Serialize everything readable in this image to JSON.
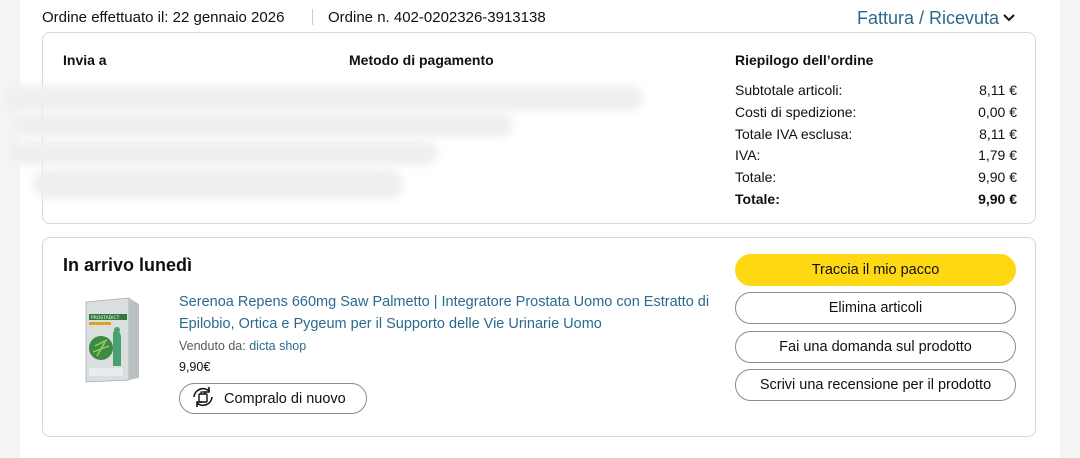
{
  "header": {
    "placed_label": "Ordine effettuato il: 22 gennaio 2026",
    "order_number": "Ordine n. 402-0202326-3913138",
    "invoice_link": "Fattura / Ricevuta"
  },
  "summary": {
    "ship_to_label": "Invia a",
    "payment_label": "Metodo di pagamento",
    "summary_label": "Riepilogo dell’ordine",
    "rows": [
      {
        "label": "Subtotale articoli:",
        "value": "8,11 €"
      },
      {
        "label": "Costi di spedizione:",
        "value": "0,00 €"
      },
      {
        "label": "Totale IVA esclusa:",
        "value": "8,11 €"
      },
      {
        "label": "IVA:",
        "value": "1,79 €"
      },
      {
        "label": "Totale:",
        "value": "9,90 €"
      },
      {
        "label": "Totale:",
        "value": "9,90 €"
      }
    ]
  },
  "shipment": {
    "status": "In arrivo lunedì",
    "product": {
      "title": "Serenoa Repens 660mg Saw Palmetto | Integratore Prostata Uomo con Estratto di Epilobio, Ortica e Pygeum per il Supporto delle Vie Urinarie Uomo",
      "sold_by_label": "Venduto da:",
      "seller": "dicta shop",
      "price": "9,90€",
      "image_brand": "PROSTADICT"
    },
    "buy_again": "Compralo di nuovo",
    "actions": {
      "track": "Traccia il mio pacco",
      "delete": "Elimina articoli",
      "ask": "Fai una domanda sul prodotto",
      "review": "Scrivi una recensione per il prodotto"
    }
  },
  "colors": {
    "link": "#2a6a8f",
    "primary_button": "#ffd814",
    "border": "#d5d9d9"
  },
  "icons": {
    "chevron": "chevron-down-icon",
    "buy_again": "buy-again-icon"
  }
}
